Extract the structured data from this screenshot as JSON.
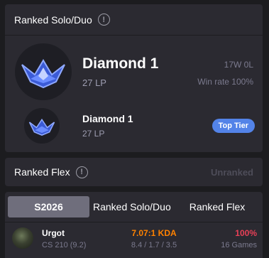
{
  "solo_duo": {
    "title": "Ranked Solo/Duo",
    "info_icon": "!",
    "current": {
      "tier": "Diamond 1",
      "lp": "27 LP",
      "record": "17W 0L",
      "win_rate": "Win rate 100%"
    },
    "peak": {
      "tier": "Diamond 1",
      "lp": "27 LP",
      "badge": "Top Tier"
    }
  },
  "flex": {
    "title": "Ranked Flex",
    "info_icon": "!",
    "status": "Unranked"
  },
  "tabs": [
    {
      "label": "S2026",
      "active": true
    },
    {
      "label": "Ranked Solo/Duo",
      "active": false
    },
    {
      "label": "Ranked Flex",
      "active": false
    }
  ],
  "champions": [
    {
      "name": "Urgot",
      "cs": "CS 210 (9.2)",
      "kda_ratio": "7.07:1 KDA",
      "kda": "8.4 / 1.7 / 3.5",
      "win_rate": "100%",
      "games": "16 Games"
    }
  ],
  "colors": {
    "accent": "#5383e8",
    "kda": "#ff8200",
    "win_rate": "#e84057",
    "emblem": "#4a6fe0"
  }
}
